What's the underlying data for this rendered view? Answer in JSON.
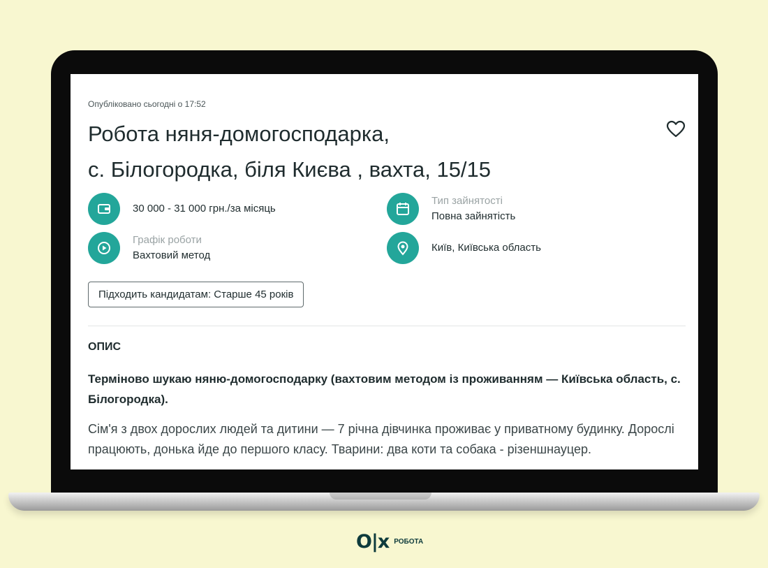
{
  "listing": {
    "posted": "Опубліковано сьогодні о 17:52",
    "title_line1": "Робота няня-домогосподарка,",
    "title_line2": "с. Білогородка, біля Києва , вахта, 15/15",
    "favorite_icon": "heart-icon"
  },
  "facts": {
    "salary": {
      "value": "30 000 - 31 000 грн./за місяць",
      "icon": "wallet-icon"
    },
    "employment": {
      "label": "Тип зайнятості",
      "value": "Повна зайнятість",
      "icon": "calendar-icon"
    },
    "schedule": {
      "label": "Графік роботи",
      "value": "Вахтовий метод",
      "icon": "play-clock-icon"
    },
    "location": {
      "value": "Київ, Київська область",
      "icon": "location-pin-icon"
    }
  },
  "tag": "Підходить кандидатам: Старше 45 років",
  "description": {
    "heading": "ОПИС",
    "bold": "Терміново шукаю няню-домогосподарку (вахтовим методом із проживанням — Київська область, с. Білогородка).",
    "text": "Сім'я з двох дорослих людей та дитини — 7 річна дівчинка проживає у приватному будинку. Дорослі працюють, донька йде до першого класу. Тварини: два коти та собака - різеншнауцер."
  },
  "logo": {
    "mark": "O|x",
    "text": "РОБОТА"
  },
  "colors": {
    "background": "#f8f7d0",
    "accent": "#23a69a",
    "text": "#1f2c2e",
    "brand": "#0e3b3c"
  }
}
